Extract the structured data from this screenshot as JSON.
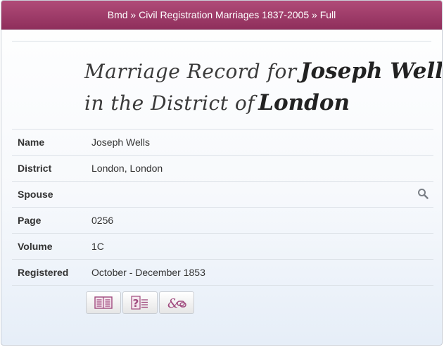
{
  "breadcrumb": {
    "part1": "Bmd",
    "sep1": "»",
    "part2": "Civil Registration Marriages 1837-2005",
    "sep2": "»",
    "part3": "Full"
  },
  "title": {
    "prefix": "Marriage Record for",
    "name": "Joseph Wells",
    "mid": "in the District of",
    "district": "London"
  },
  "record": [
    {
      "label": "Name",
      "value": "Joseph Wells"
    },
    {
      "label": "District",
      "value": "London, London"
    },
    {
      "label": "Spouse",
      "value": ""
    },
    {
      "label": "Page",
      "value": "0256"
    },
    {
      "label": "Volume",
      "value": "1C"
    },
    {
      "label": "Registered",
      "value": "October - December 1853"
    }
  ],
  "icons": {
    "spouse_search": "search-icon",
    "buttons": [
      "record-details-icon",
      "question-document-icon",
      "link-icon"
    ]
  },
  "colors": {
    "header": "#9e3b68",
    "icon_accent": "#a04a7e"
  }
}
